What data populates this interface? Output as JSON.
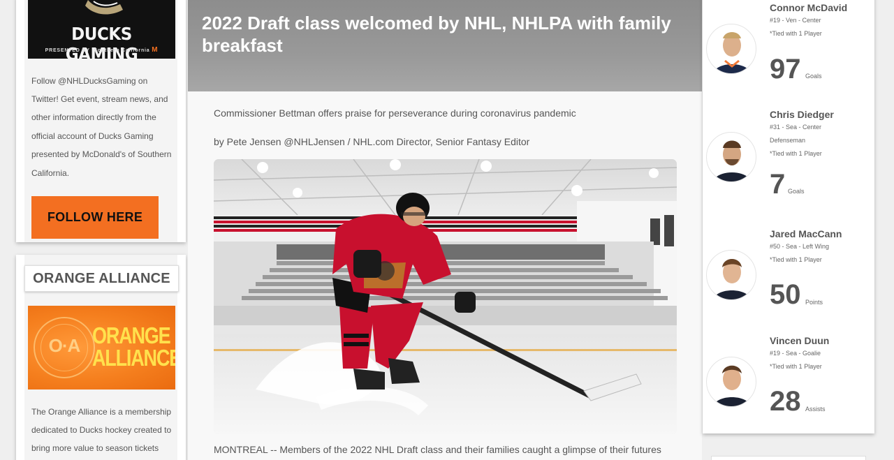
{
  "sidebar": {
    "ducks_gaming": {
      "title": "DUCKS GAMING",
      "presented_by": "PRESENTED BY",
      "sponsor": "Southern California",
      "sponsor_mark": "M",
      "description_lines": [
        "Follow @NHLDucksGaming on",
        "Twitter! Get event, stream news, and",
        "other information directly from the",
        "official account of Ducks Gaming",
        "presented by McDonald's of Southern",
        "California."
      ],
      "button_label": "FOLLOW HERE"
    },
    "orange_alliance": {
      "heading": "ORANGE ALLIANCE",
      "banner_monogram": "O·A",
      "banner_word_1": "ORANGE",
      "banner_word_2": "ALLIANCE",
      "description_lines": [
        "The Orange Alliance is a membership",
        "dedicated to Ducks hockey created to",
        "bring more value to season tickets"
      ]
    }
  },
  "article": {
    "title": "2022 Draft class welcomed by NHL, NHLPA with family breakfast",
    "subtitle": "Commissioner Bettman offers praise for perseverance during coronavirus pandemic",
    "byline": "by Pete Jensen @NHLJensen / NHL.com Director, Senior Fantasy Editor",
    "lede": "MONTREAL -- Members of the 2022 NHL Draft class and their families caught a glimpse of their futures"
  },
  "leaders": [
    {
      "name": "Connor McDavid",
      "meta": [
        "#19 - Ven - Center",
        "*Tied with 1 Player"
      ],
      "stat": "97",
      "unit": "Goals"
    },
    {
      "name": "Chris Diedger",
      "meta": [
        "#31 - Sea - Center",
        "Defenseman",
        "*Tied with 1 Player"
      ],
      "stat": "7",
      "unit": "Goals"
    },
    {
      "name": "Jared MacCann",
      "meta": [
        "#50 - Sea - Left Wing",
        "*Tied with 1 Player"
      ],
      "stat": "50",
      "unit": "Points"
    },
    {
      "name": "Vincen Duun",
      "meta": [
        "#19 - Sea - Goalie",
        "*Tied with 1 Player"
      ],
      "stat": "28",
      "unit": "Assists"
    }
  ],
  "colors": {
    "accent_orange": "#f36f21",
    "hero_gray": "#999999",
    "jersey_red": "#c8102e"
  },
  "icons": [
    "ducks-logo-icon",
    "orange-alliance-logo-icon",
    "player-headshot-icon"
  ]
}
